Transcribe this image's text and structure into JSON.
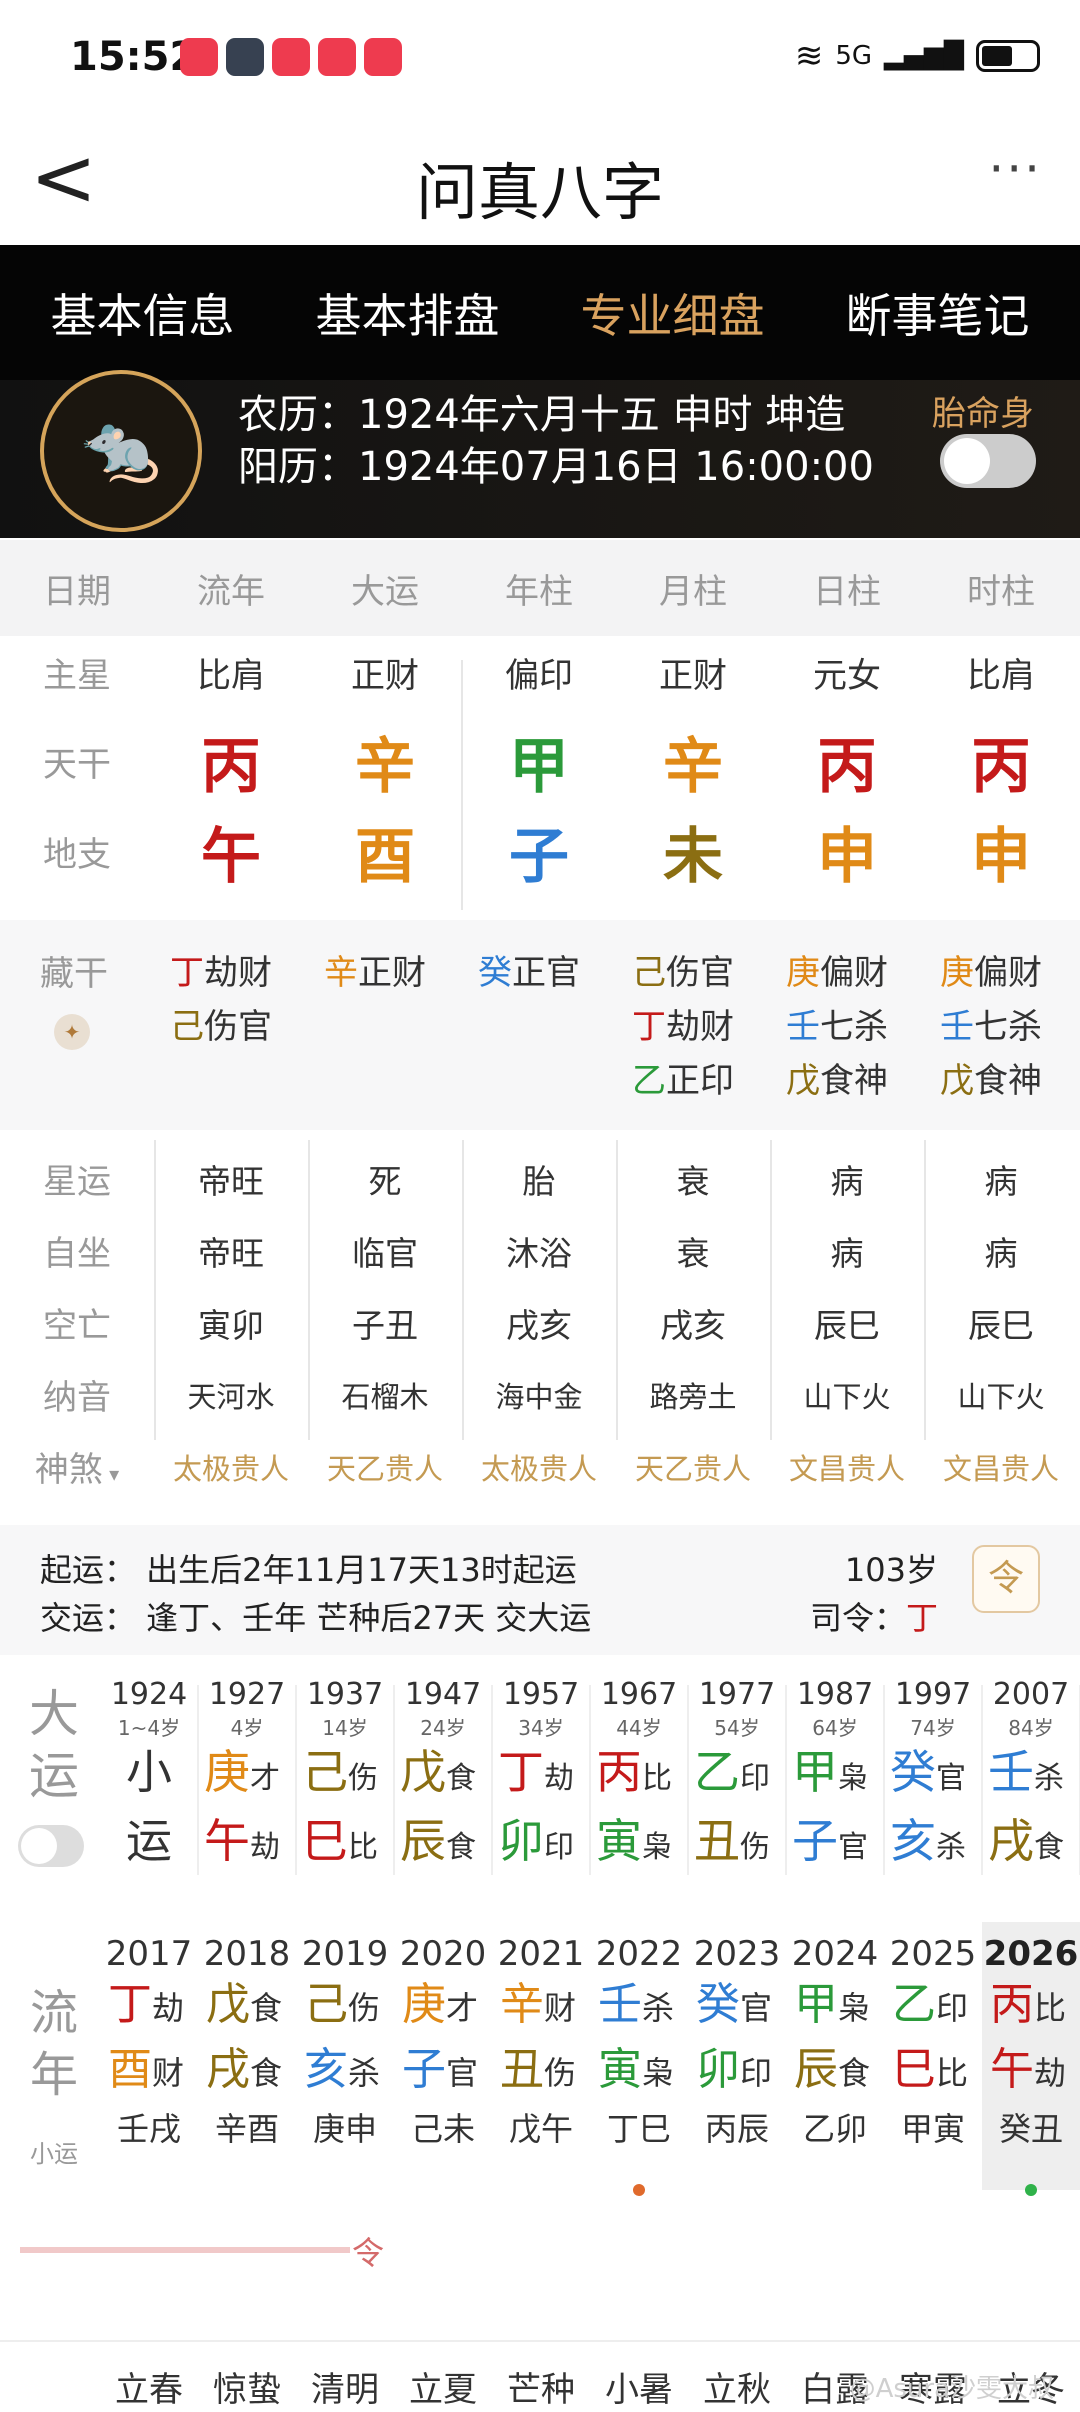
{
  "status": {
    "time": "15:52",
    "network": "5G"
  },
  "header": {
    "title": "问真八字",
    "back": "<",
    "more": "···"
  },
  "tabs": [
    "基本信息",
    "基本排盘",
    "专业细盘",
    "断事笔记"
  ],
  "info": {
    "lunar": "农历：1924年六月十五 申时 坤造",
    "solar": "阳历：1924年07月16日 16:00:00",
    "embryo": "胎命身"
  },
  "columns": [
    "日期",
    "流年",
    "大运",
    "年柱",
    "月柱",
    "日柱",
    "时柱"
  ],
  "main_star": {
    "label": "主星",
    "values": [
      "比肩",
      "正财",
      "偏印",
      "正财",
      "元女",
      "比肩"
    ]
  },
  "tiangan": {
    "label": "天干",
    "values": [
      "丙",
      "辛",
      "甲",
      "辛",
      "丙",
      "丙"
    ],
    "colors": [
      "red",
      "orange",
      "green",
      "orange",
      "red",
      "red"
    ]
  },
  "dizhi": {
    "label": "地支",
    "values": [
      "午",
      "酉",
      "子",
      "未",
      "申",
      "申"
    ],
    "colors": [
      "red",
      "orange",
      "blue",
      "brown",
      "orange",
      "orange"
    ]
  },
  "canggan": {
    "label": "藏干",
    "cols": [
      [
        [
          "丁",
          "劫财",
          "red"
        ],
        [
          "己",
          "伤官",
          "brown"
        ]
      ],
      [
        [
          "辛",
          "正财",
          "orange"
        ]
      ],
      [
        [
          "癸",
          "正官",
          "blue"
        ]
      ],
      [
        [
          "己",
          "伤官",
          "brown"
        ],
        [
          "丁",
          "劫财",
          "red"
        ],
        [
          "乙",
          "正印",
          "green"
        ]
      ],
      [
        [
          "庚",
          "偏财",
          "orange"
        ],
        [
          "壬",
          "七杀",
          "blue"
        ],
        [
          "戊",
          "食神",
          "brown"
        ]
      ],
      [
        [
          "庚",
          "偏财",
          "orange"
        ],
        [
          "壬",
          "七杀",
          "blue"
        ],
        [
          "戊",
          "食神",
          "brown"
        ]
      ]
    ]
  },
  "xingyun": {
    "label": "星运",
    "values": [
      "帝旺",
      "死",
      "胎",
      "衰",
      "病",
      "病"
    ]
  },
  "zizuo": {
    "label": "自坐",
    "values": [
      "帝旺",
      "临官",
      "沐浴",
      "衰",
      "病",
      "病"
    ]
  },
  "kongwang": {
    "label": "空亡",
    "values": [
      "寅卯",
      "子丑",
      "戌亥",
      "戌亥",
      "辰巳",
      "辰巳"
    ]
  },
  "nayin": {
    "label": "纳音",
    "values": [
      "天河水",
      "石榴木",
      "海中金",
      "路旁土",
      "山下火",
      "山下火"
    ]
  },
  "shensha": {
    "label": "神煞",
    "values": [
      "太极贵人",
      "天乙贵人",
      "太极贵人",
      "天乙贵人",
      "文昌贵人",
      "文昌贵人"
    ]
  },
  "yun": {
    "qiyun": "起运：  出生后2年11月17天13时起运",
    "jiaoyun": "交运：  逢丁、壬年 芒种后27天 交大运",
    "age": "103岁",
    "siling_label": "司令：",
    "siling_value": "丁",
    "ling_icon": "令"
  },
  "dayun": {
    "label": "大运",
    "cols": [
      {
        "yr": "1924",
        "age": "1~4岁",
        "g": "小",
        "gs": "",
        "gc": "dark",
        "z": "运",
        "zs": "",
        "zc": "dark"
      },
      {
        "yr": "1927",
        "age": "4岁",
        "g": "庚",
        "gs": "才",
        "gc": "orange",
        "z": "午",
        "zs": "劫",
        "zc": "red"
      },
      {
        "yr": "1937",
        "age": "14岁",
        "g": "己",
        "gs": "伤",
        "gc": "brown",
        "z": "巳",
        "zs": "比",
        "zc": "red"
      },
      {
        "yr": "1947",
        "age": "24岁",
        "g": "戊",
        "gs": "食",
        "gc": "brown",
        "z": "辰",
        "zs": "食",
        "zc": "brown"
      },
      {
        "yr": "1957",
        "age": "34岁",
        "g": "丁",
        "gs": "劫",
        "gc": "red",
        "z": "卯",
        "zs": "印",
        "zc": "green"
      },
      {
        "yr": "1967",
        "age": "44岁",
        "g": "丙",
        "gs": "比",
        "gc": "red",
        "z": "寅",
        "zs": "枭",
        "zc": "green"
      },
      {
        "yr": "1977",
        "age": "54岁",
        "g": "乙",
        "gs": "印",
        "gc": "green",
        "z": "丑",
        "zs": "伤",
        "zc": "brown"
      },
      {
        "yr": "1987",
        "age": "64岁",
        "g": "甲",
        "gs": "枭",
        "gc": "green",
        "z": "子",
        "zs": "官",
        "zc": "blue"
      },
      {
        "yr": "1997",
        "age": "74岁",
        "g": "癸",
        "gs": "官",
        "gc": "blue",
        "z": "亥",
        "zs": "杀",
        "zc": "blue"
      },
      {
        "yr": "2007",
        "age": "84岁",
        "g": "壬",
        "gs": "杀",
        "gc": "blue",
        "z": "戌",
        "zs": "食",
        "zc": "brown"
      }
    ]
  },
  "liunian": {
    "label": "流年",
    "sublabel": "小运",
    "cols": [
      {
        "yr": "2017",
        "g": "丁",
        "gs": "劫",
        "gc": "red",
        "z": "酉",
        "zs": "财",
        "zc": "orange",
        "x": "壬戌"
      },
      {
        "yr": "2018",
        "g": "戊",
        "gs": "食",
        "gc": "brown",
        "z": "戌",
        "zs": "食",
        "zc": "brown",
        "x": "辛酉"
      },
      {
        "yr": "2019",
        "g": "己",
        "gs": "伤",
        "gc": "brown",
        "z": "亥",
        "zs": "杀",
        "zc": "blue",
        "x": "庚申"
      },
      {
        "yr": "2020",
        "g": "庚",
        "gs": "才",
        "gc": "orange",
        "z": "子",
        "zs": "官",
        "zc": "blue",
        "x": "己未"
      },
      {
        "yr": "2021",
        "g": "辛",
        "gs": "财",
        "gc": "orange",
        "z": "丑",
        "zs": "伤",
        "zc": "brown",
        "x": "戊午"
      },
      {
        "yr": "2022",
        "g": "壬",
        "gs": "杀",
        "gc": "blue",
        "z": "寅",
        "zs": "枭",
        "zc": "green",
        "x": "丁巳"
      },
      {
        "yr": "2023",
        "g": "癸",
        "gs": "官",
        "gc": "blue",
        "z": "卯",
        "zs": "印",
        "zc": "green",
        "x": "丙辰"
      },
      {
        "yr": "2024",
        "g": "甲",
        "gs": "枭",
        "gc": "green",
        "z": "辰",
        "zs": "食",
        "zc": "brown",
        "x": "乙卯"
      },
      {
        "yr": "2025",
        "g": "乙",
        "gs": "印",
        "gc": "green",
        "z": "巳",
        "zs": "比",
        "zc": "red",
        "x": "甲寅"
      },
      {
        "yr": "2026",
        "g": "丙",
        "gs": "比",
        "gc": "red",
        "z": "午",
        "zs": "劫",
        "zc": "red",
        "x": "癸丑"
      }
    ]
  },
  "terms": [
    "立春",
    "惊蛰",
    "清明",
    "立夏",
    "芒种",
    "小暑",
    "立秋",
    "白露",
    "寒露",
    "立冬"
  ],
  "extra_glyph": "令",
  "watermark": "@Asura沙雯大叔"
}
